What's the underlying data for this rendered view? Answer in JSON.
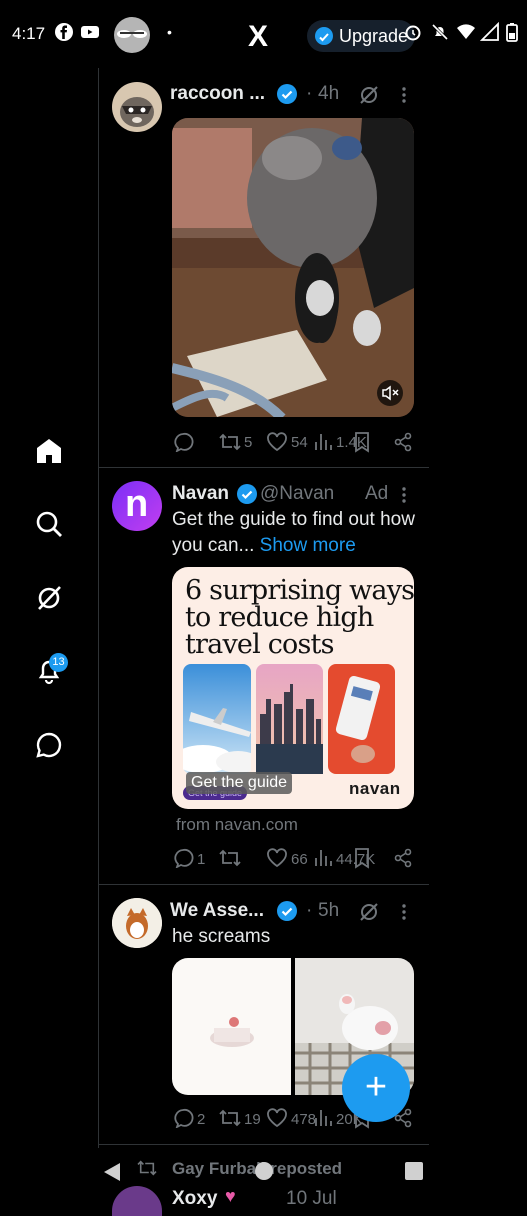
{
  "status_bar": {
    "time": "4:17"
  },
  "header": {
    "logo": "X",
    "upgrade_label": "Upgrade"
  },
  "sidebar": {
    "notification_count": "13"
  },
  "tweets": [
    {
      "name": "raccoon ...",
      "verified": true,
      "time": "4h",
      "actions": {
        "replies": "",
        "retweets": "5",
        "likes": "54",
        "views": "1.4K"
      }
    },
    {
      "name": "Navan",
      "verified": true,
      "handle": "@Navan",
      "ad_label": "Ad",
      "text": "Get the guide to find out how you can...",
      "show_more": "Show more",
      "ad_card": {
        "headline_1": "6 surprising ways",
        "headline_2": "to reduce high",
        "headline_3": "travel costs",
        "small_button": "Get the guide",
        "cta": "Get the guide",
        "brand": "navan"
      },
      "source": "from navan.com",
      "actions": {
        "replies": "1",
        "retweets": "",
        "likes": "66",
        "views": "44.7K"
      }
    },
    {
      "name": "We Asse...",
      "verified": true,
      "time": "5h",
      "text": "he screams",
      "actions": {
        "replies": "2",
        "retweets": "19",
        "likes": "478",
        "views": "20K"
      }
    },
    {
      "repost_label": "Gay Furball reposted",
      "name": "Xoxy",
      "time": "10 Jul"
    }
  ],
  "colors": {
    "accent": "#1d9bf0",
    "background": "#000000",
    "muted": "#71767b"
  }
}
